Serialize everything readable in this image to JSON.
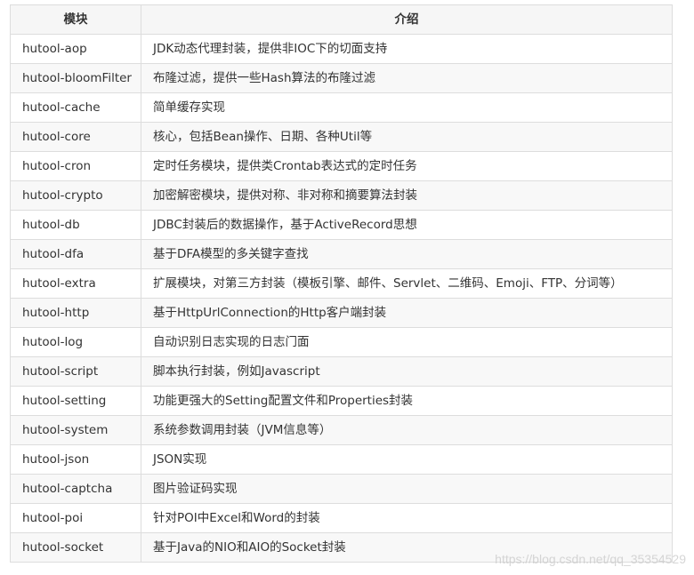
{
  "table": {
    "headers": [
      "模块",
      "介绍"
    ],
    "rows": [
      {
        "module": "hutool-aop",
        "desc": "JDK动态代理封装，提供非IOC下的切面支持"
      },
      {
        "module": "hutool-bloomFilter",
        "desc": "布隆过滤，提供一些Hash算法的布隆过滤"
      },
      {
        "module": "hutool-cache",
        "desc": "简单缓存实现"
      },
      {
        "module": "hutool-core",
        "desc": "核心，包括Bean操作、日期、各种Util等"
      },
      {
        "module": "hutool-cron",
        "desc": "定时任务模块，提供类Crontab表达式的定时任务"
      },
      {
        "module": "hutool-crypto",
        "desc": "加密解密模块，提供对称、非对称和摘要算法封装"
      },
      {
        "module": "hutool-db",
        "desc": "JDBC封装后的数据操作，基于ActiveRecord思想"
      },
      {
        "module": "hutool-dfa",
        "desc": "基于DFA模型的多关键字查找"
      },
      {
        "module": "hutool-extra",
        "desc": "扩展模块，对第三方封装（模板引擎、邮件、Servlet、二维码、Emoji、FTP、分词等）"
      },
      {
        "module": "hutool-http",
        "desc": "基于HttpUrlConnection的Http客户端封装"
      },
      {
        "module": "hutool-log",
        "desc": "自动识别日志实现的日志门面"
      },
      {
        "module": "hutool-script",
        "desc": "脚本执行封装，例如Javascript"
      },
      {
        "module": "hutool-setting",
        "desc": "功能更强大的Setting配置文件和Properties封装"
      },
      {
        "module": "hutool-system",
        "desc": "系统参数调用封装（JVM信息等）"
      },
      {
        "module": "hutool-json",
        "desc": "JSON实现"
      },
      {
        "module": "hutool-captcha",
        "desc": "图片验证码实现"
      },
      {
        "module": "hutool-poi",
        "desc": "针对POI中Excel和Word的封装"
      },
      {
        "module": "hutool-socket",
        "desc": "基于Java的NIO和AIO的Socket封装"
      }
    ]
  },
  "watermark": "https://blog.csdn.net/qq_35354529"
}
